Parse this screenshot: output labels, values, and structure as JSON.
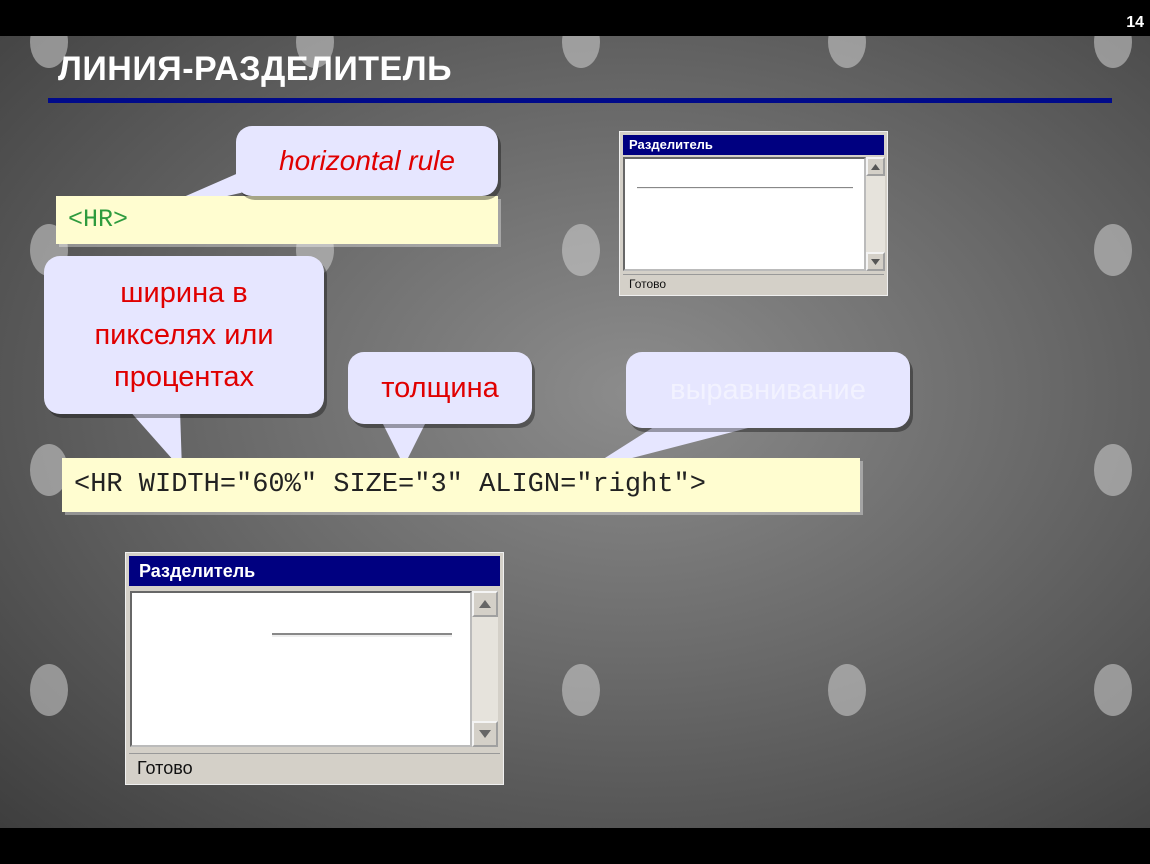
{
  "slide": {
    "page_number": "14",
    "title": "ЛИНИЯ-РАЗДЕЛИТЕЛЬ",
    "colors": {
      "title_rule": "#000a8a",
      "bubble_bg": "#e6e6ff",
      "bubble_text": "#e00000",
      "code_bg": "#fffdd0",
      "tag_text": "#2e9b3e"
    }
  },
  "code": {
    "simple": "<HR>",
    "full": "<HR WIDTH=\"60%\" SIZE=\"3\" ALIGN=\"right\">"
  },
  "callouts": {
    "hr": "horizontal rule",
    "width": "ширина в пикселях или процентах",
    "size": "толщина",
    "align": "выравнивание"
  },
  "window_top": {
    "title": "Разделитель",
    "status": "Готово",
    "scroll_up_icon": "triangle-up",
    "scroll_down_icon": "triangle-down"
  },
  "window_bottom": {
    "title": "Разделитель",
    "status": "Готово",
    "scroll_up_icon": "triangle-up",
    "scroll_down_icon": "triangle-down"
  }
}
